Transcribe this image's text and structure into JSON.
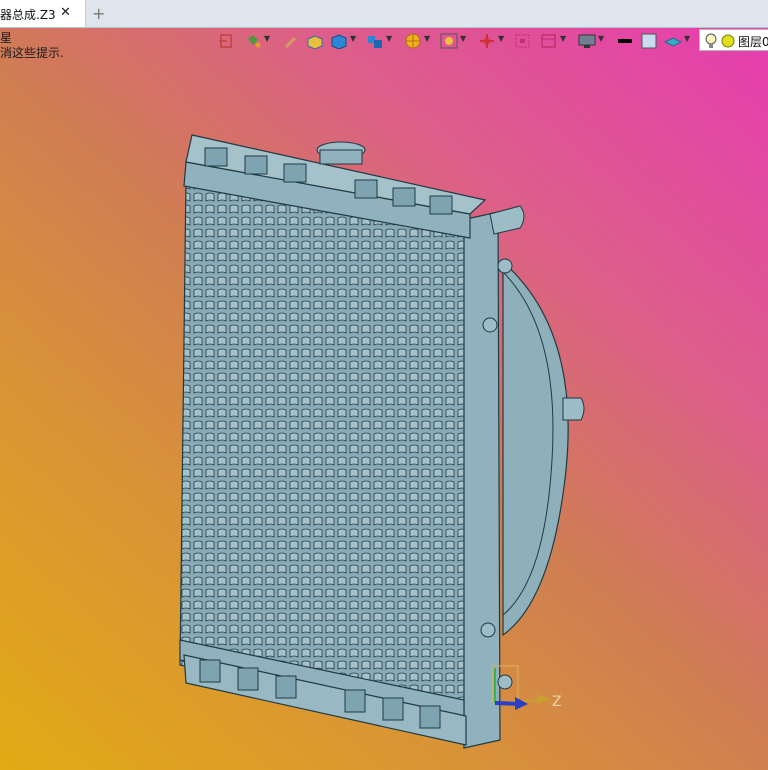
{
  "tab": {
    "title": "器总成.Z3",
    "close_icon": "close-icon",
    "add_icon": "plus-icon"
  },
  "hint": {
    "line1": "星",
    "line2": "消这些提示."
  },
  "toolbar": {
    "items": [
      "exit-icon",
      "paint-bucket-icon",
      "pen-icon",
      "solid-box-icon",
      "cube-icon",
      "multi-cube-icon",
      "sphere-section-icon",
      "zoom-fit-icon",
      "move-axis-icon",
      "frame-select-icon",
      "frame-icon",
      "monitor-icon",
      "line-color-swatch",
      "fill-color-swatch",
      "plane-icon"
    ],
    "colors": {
      "line": "#000000",
      "fill": "#c8dcef"
    }
  },
  "layer": {
    "label": "图层0",
    "bulb_icon": "lightbulb-icon",
    "dot_icon": "layer-status-dot"
  },
  "axis": {
    "z_label": "Z"
  },
  "colors": {
    "part": "#8fb2be",
    "edge": "#1f3a44",
    "bg_top": "#e63db0",
    "bg_bottom": "#e3aa14"
  }
}
